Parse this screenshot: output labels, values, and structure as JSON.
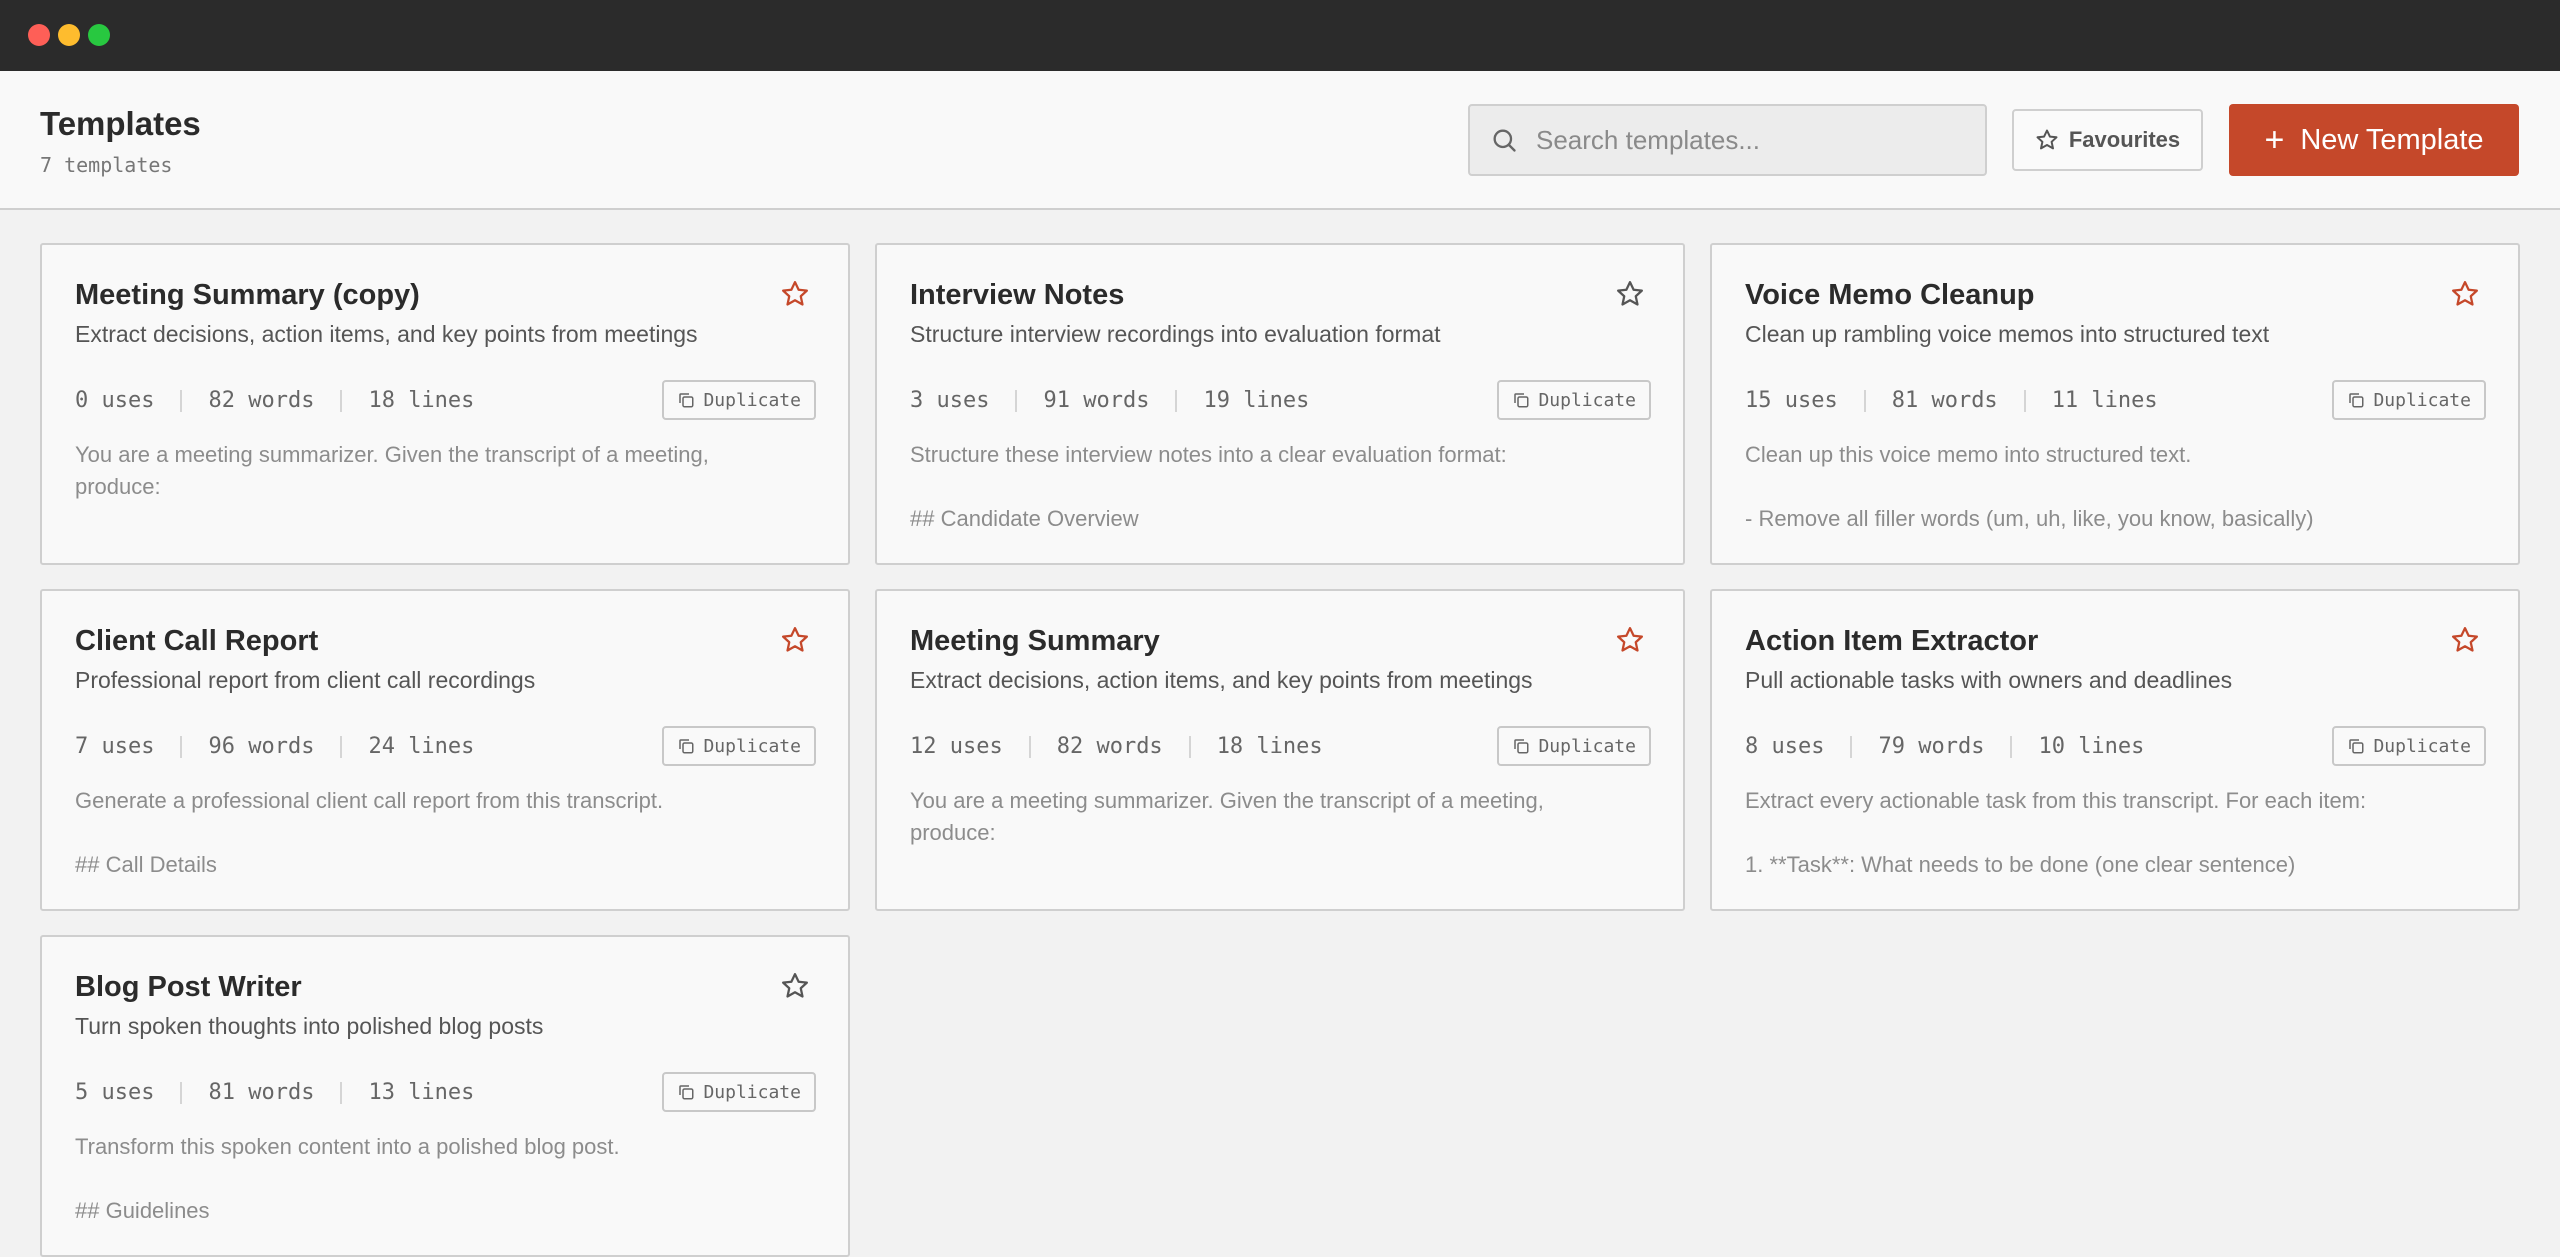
{
  "header": {
    "title": "Templates",
    "count": "7 templates",
    "search_placeholder": "Search templates...",
    "favourites_label": "Favourites",
    "new_label": "New Template"
  },
  "colors": {
    "accent": "#c5482a",
    "star_active": "#c5482a",
    "star_inactive": "#555555"
  },
  "templates": [
    {
      "title": "Meeting Summary (copy)",
      "description": "Extract decisions, action items, and key points from meetings",
      "uses": "0 uses",
      "words": "82 words",
      "lines": "18 lines",
      "favourite": true,
      "duplicate_label": "Duplicate",
      "preview": "You are a meeting summarizer. Given the transcript of a meeting,\nproduce:"
    },
    {
      "title": "Interview Notes",
      "description": "Structure interview recordings into evaluation format",
      "uses": "3 uses",
      "words": "91 words",
      "lines": "19 lines",
      "favourite": false,
      "duplicate_label": "Duplicate",
      "preview": "Structure these interview notes into a clear evaluation format:\n\n## Candidate Overview"
    },
    {
      "title": "Voice Memo Cleanup",
      "description": "Clean up rambling voice memos into structured text",
      "uses": "15 uses",
      "words": "81 words",
      "lines": "11 lines",
      "favourite": true,
      "duplicate_label": "Duplicate",
      "preview": "Clean up this voice memo into structured text.\n\n- Remove all filler words (um, uh, like, you know, basically)"
    },
    {
      "title": "Client Call Report",
      "description": "Professional report from client call recordings",
      "uses": "7 uses",
      "words": "96 words",
      "lines": "24 lines",
      "favourite": true,
      "duplicate_label": "Duplicate",
      "preview": "Generate a professional client call report from this transcript.\n\n## Call Details"
    },
    {
      "title": "Meeting Summary",
      "description": "Extract decisions, action items, and key points from meetings",
      "uses": "12 uses",
      "words": "82 words",
      "lines": "18 lines",
      "favourite": true,
      "duplicate_label": "Duplicate",
      "preview": "You are a meeting summarizer. Given the transcript of a meeting,\nproduce:"
    },
    {
      "title": "Action Item Extractor",
      "description": "Pull actionable tasks with owners and deadlines",
      "uses": "8 uses",
      "words": "79 words",
      "lines": "10 lines",
      "favourite": true,
      "duplicate_label": "Duplicate",
      "preview": "Extract every actionable task from this transcript. For each item:\n\n1. **Task**: What needs to be done (one clear sentence)"
    },
    {
      "title": "Blog Post Writer",
      "description": "Turn spoken thoughts into polished blog posts",
      "uses": "5 uses",
      "words": "81 words",
      "lines": "13 lines",
      "favourite": false,
      "duplicate_label": "Duplicate",
      "preview": "Transform this spoken content into a polished blog post.\n\n## Guidelines"
    }
  ]
}
